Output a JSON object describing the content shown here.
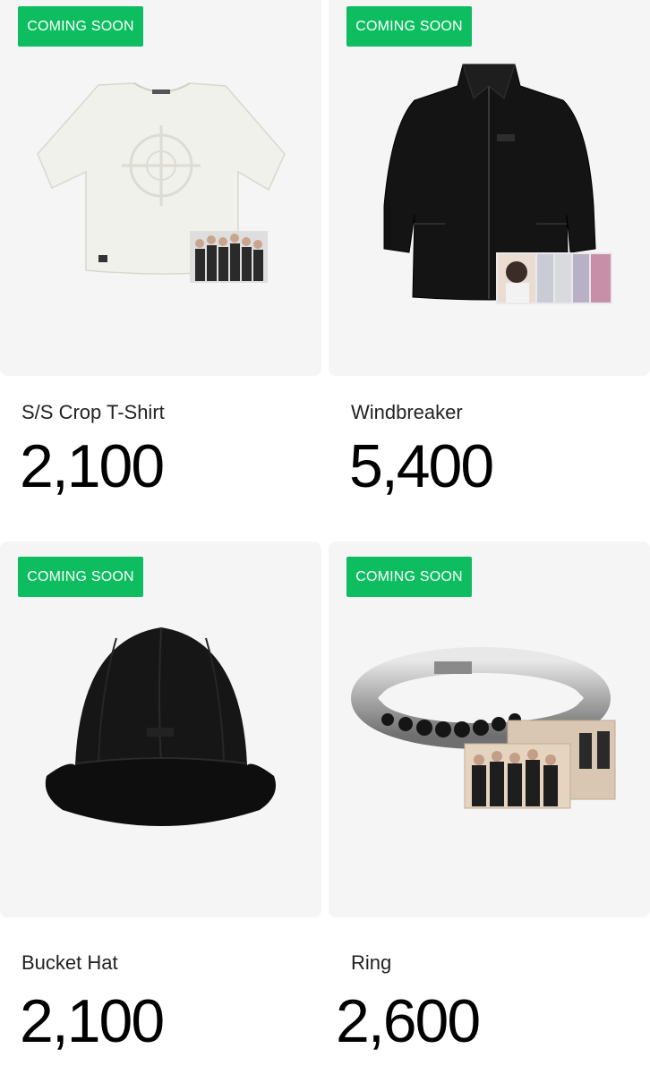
{
  "products": [
    {
      "badge": "COMING SOON",
      "name": "S/S Crop T-Shirt",
      "price": "2,100",
      "image_icon": "tshirt-icon"
    },
    {
      "badge": "COMING SOON",
      "name": "Windbreaker",
      "price": "5,400",
      "image_icon": "jacket-icon"
    },
    {
      "badge": "COMING SOON",
      "name": "Bucket Hat",
      "price": "2,100",
      "image_icon": "bucket-hat-icon"
    },
    {
      "badge": "COMING SOON",
      "name": "Ring",
      "price": "2,600",
      "image_icon": "ring-icon"
    }
  ],
  "colors": {
    "badge_green": "#0dbd5f",
    "card_bg": "#f5f5f5"
  }
}
